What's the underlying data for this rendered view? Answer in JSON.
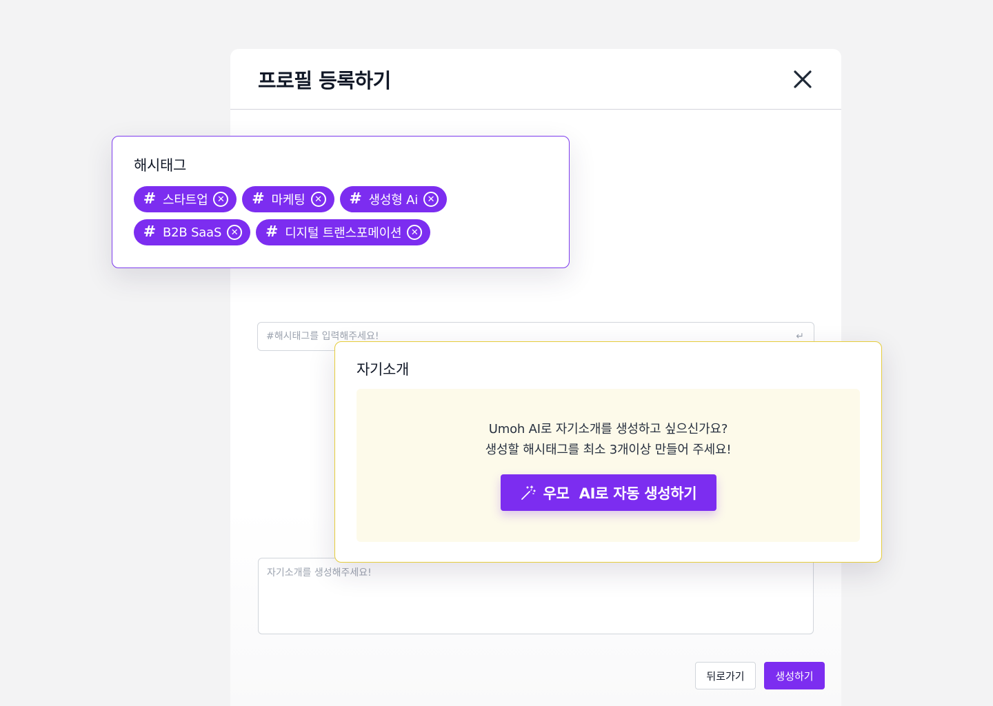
{
  "modal": {
    "title": "프로필 등록하기",
    "close_icon": "close-icon",
    "hashtag_input_placeholder": "#해시태그를 입력해주세요!",
    "enter_icon": "↵",
    "intro_placeholder": "자기소개를 생성해주세요!",
    "back_label": "뒤로가기",
    "create_label": "생성하기"
  },
  "hashtag_card": {
    "title": "해시태그",
    "chips": [
      {
        "label": "스타트업"
      },
      {
        "label": "마케팅"
      },
      {
        "label": "생성형 Ai"
      },
      {
        "label": "B2B SaaS"
      },
      {
        "label": "디지털 트랜스포메이션"
      }
    ],
    "hash_symbol": "#",
    "remove_symbol": "✕"
  },
  "intro_card": {
    "title": "자기소개",
    "line1": "Umoh AI로 자기소개를 생성하고 싶으신가요?",
    "line2": "생성할 해시태그를 최소 3개이상 만들어 주세요!",
    "ai_button_label": "우모  AI로 자동 생성하기",
    "ai_button_icon": "magic-wand-icon"
  },
  "colors": {
    "accent": "#7c2df0",
    "intro_border": "#e5cc3a",
    "intro_panel": "#fdfaea",
    "background": "#f3f3f4"
  }
}
